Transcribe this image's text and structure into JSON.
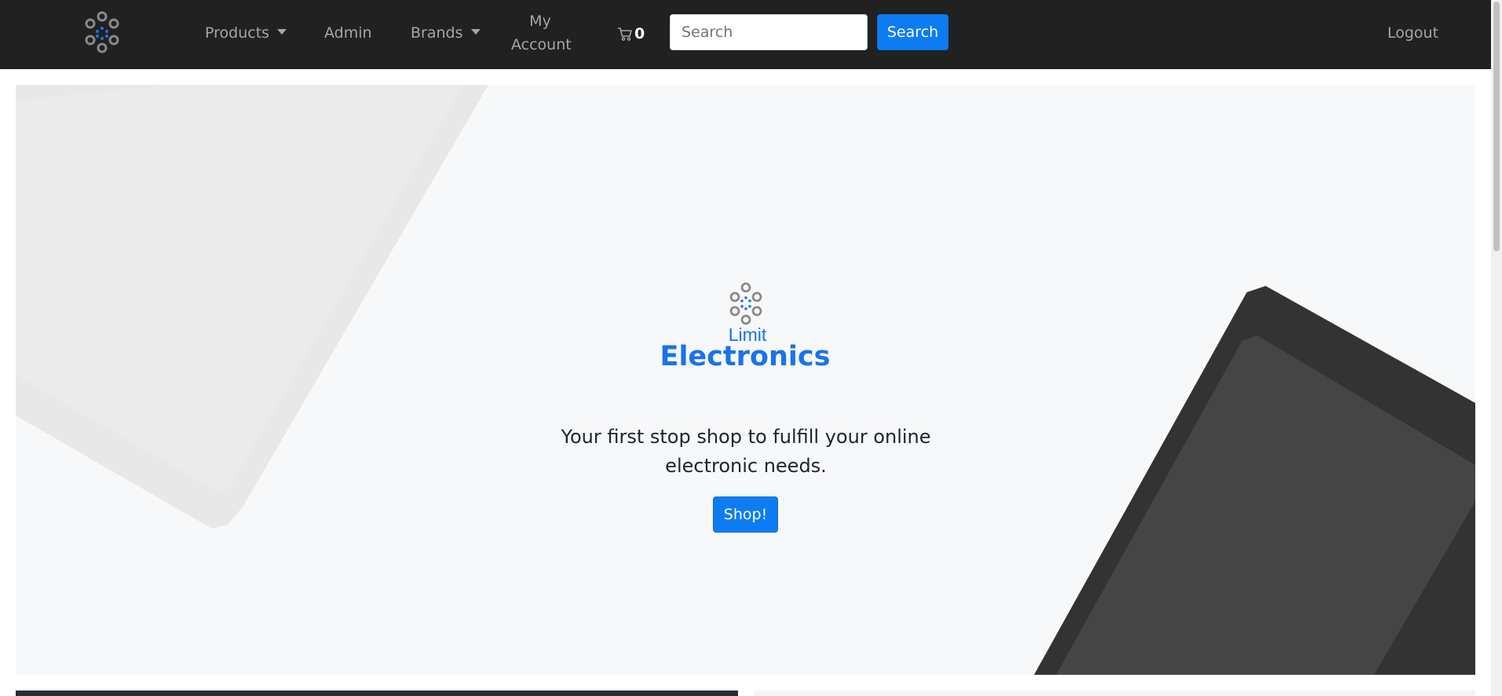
{
  "navbar": {
    "logo_icon": "dots-cluster-logo-icon",
    "products_label": "Products",
    "admin_label": "Admin",
    "brands_label": "Brands",
    "account_line1": "My",
    "account_line2": "Account",
    "cart_icon": "cart-icon",
    "cart_count": "0",
    "search_placeholder": "Search",
    "search_button": "Search",
    "logout_label": "Logout"
  },
  "hero": {
    "brand_small": "Limit",
    "brand_large": "Electronics",
    "tagline": "Your first stop shop to fulfill your online electronic needs.",
    "shop_button": "Shop!"
  },
  "colors": {
    "navbar_bg": "#212121",
    "accent": "#0d7cf2",
    "hero_bg": "#f7f8fa",
    "phone_dark": "#333333",
    "phone_light": "#e6e6e6"
  }
}
